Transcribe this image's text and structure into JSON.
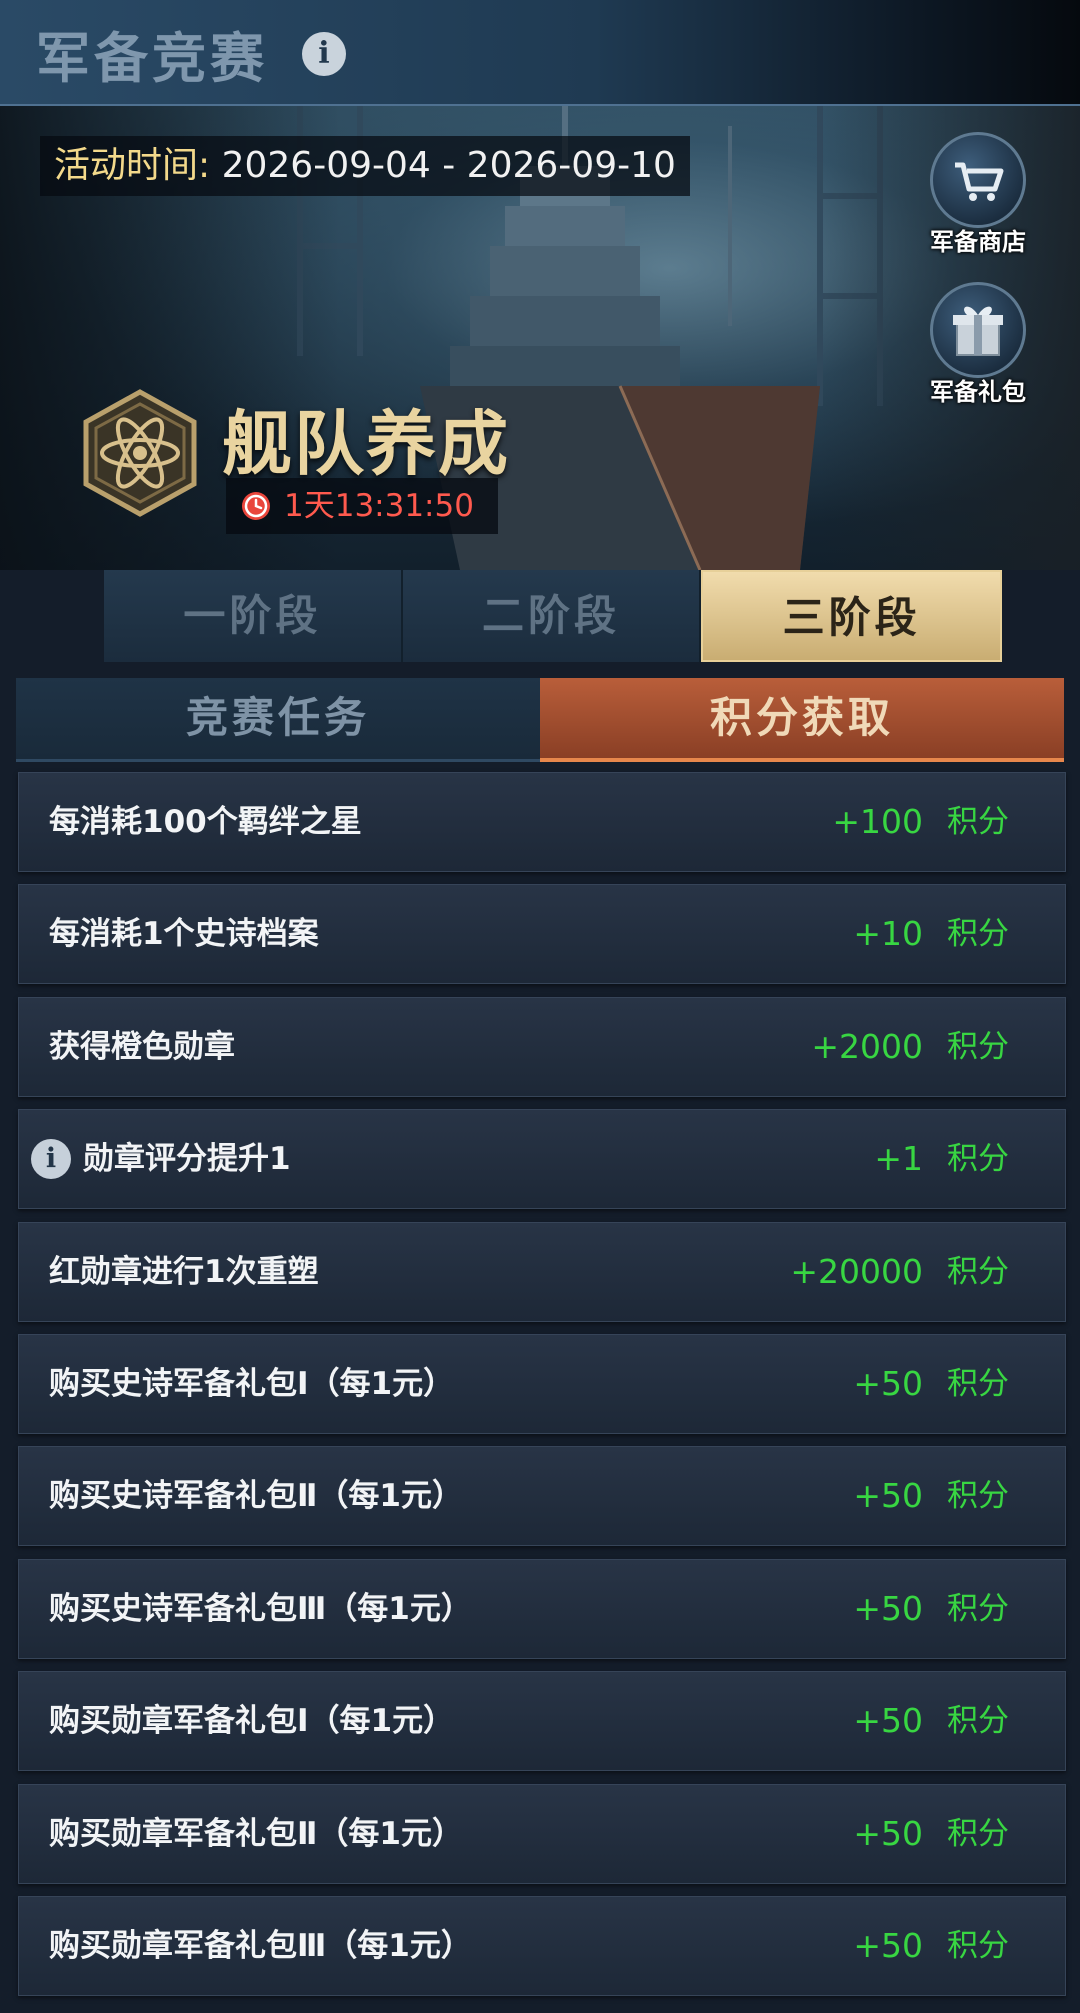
{
  "header": {
    "title": "军备竞赛",
    "info_icon": "info-icon"
  },
  "banner": {
    "time_label": "活动时间:",
    "time_value": " 2026-09-04 - 2026-09-10",
    "event_title": "舰队养成",
    "countdown": "1天13:31:50",
    "shop_label": "军备商店",
    "shop_icon": "cart-icon",
    "gift_label": "军备礼包",
    "gift_icon": "gift-icon",
    "emblem_icon": "atom-emblem-icon"
  },
  "stage_tabs": [
    {
      "label": "一阶段",
      "active": false
    },
    {
      "label": "二阶段",
      "active": false
    },
    {
      "label": "三阶段",
      "active": true
    }
  ],
  "sub_tabs": [
    {
      "label": "竞赛任务",
      "active": false
    },
    {
      "label": "积分获取",
      "active": true
    }
  ],
  "colors": {
    "points": "#38d642",
    "accent_gold": "#e9d4a0",
    "tab_active": "#b95e3a",
    "timer": "#ff5a4e"
  },
  "rows": [
    {
      "label": "每消耗100个羁绊之星",
      "value": "+100",
      "unit": "积分"
    },
    {
      "label": "每消耗1个史诗档案",
      "value": "+10",
      "unit": "积分"
    },
    {
      "label": "获得橙色勋章",
      "value": "+2000",
      "unit": "积分"
    },
    {
      "label": "勋章评分提升1",
      "value": "+1",
      "unit": "积分",
      "info": true
    },
    {
      "label": "红勋章进行1次重塑",
      "value": "+20000",
      "unit": "积分"
    },
    {
      "label": "购买史诗军备礼包Ⅰ（每1元）",
      "value": "+50",
      "unit": "积分"
    },
    {
      "label": "购买史诗军备礼包Ⅱ（每1元）",
      "value": "+50",
      "unit": "积分"
    },
    {
      "label": "购买史诗军备礼包Ⅲ（每1元）",
      "value": "+50",
      "unit": "积分"
    },
    {
      "label": "购买勋章军备礼包Ⅰ（每1元）",
      "value": "+50",
      "unit": "积分"
    },
    {
      "label": "购买勋章军备礼包Ⅱ（每1元）",
      "value": "+50",
      "unit": "积分"
    },
    {
      "label": "购买勋章军备礼包Ⅲ（每1元）",
      "value": "+50",
      "unit": "积分"
    }
  ]
}
